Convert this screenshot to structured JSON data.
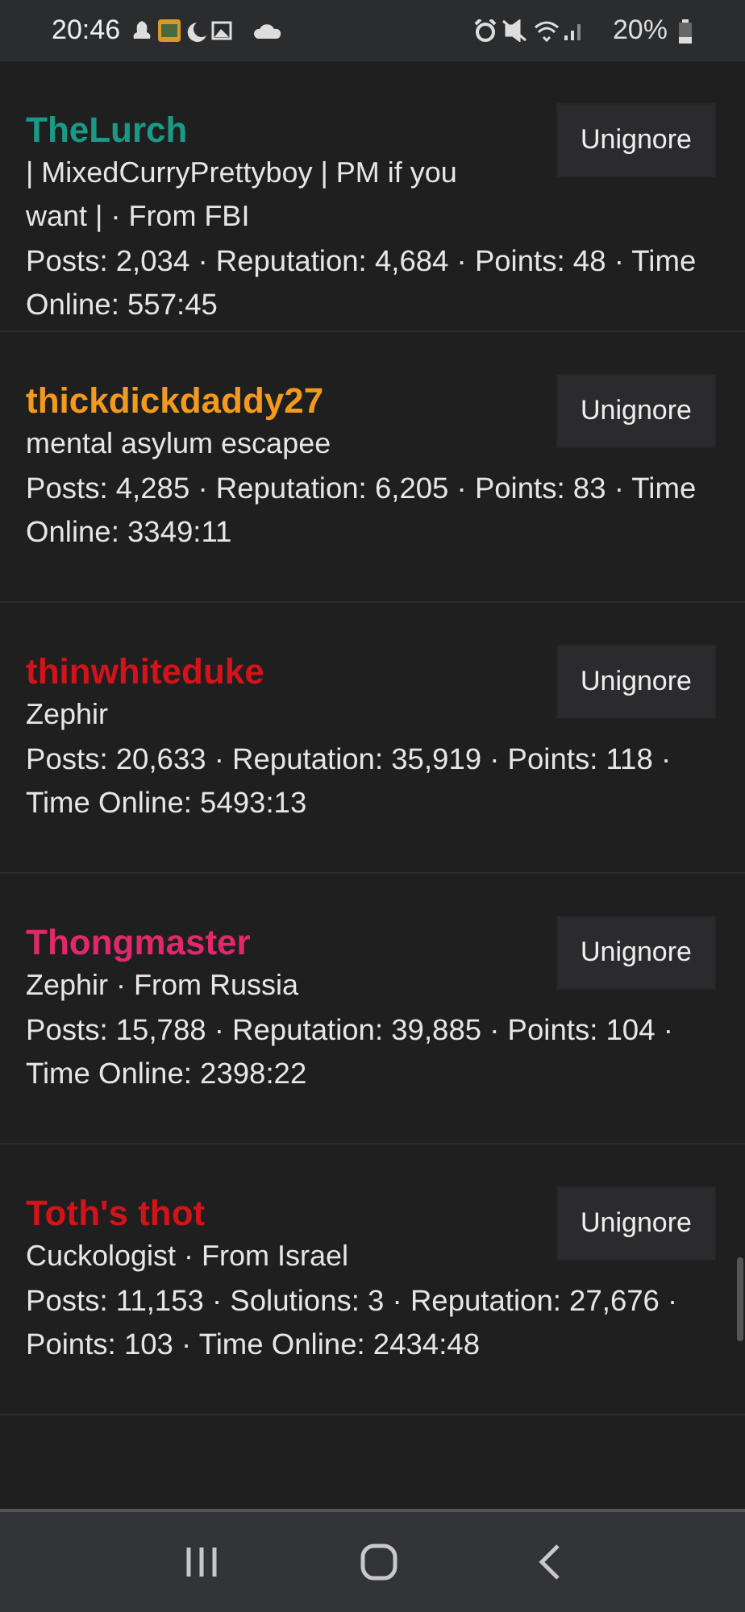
{
  "status_bar": {
    "time": "20:46",
    "battery": "20%"
  },
  "members": [
    {
      "name": "TheLurch",
      "color": "#1a9a86",
      "meta": "| MixedCurryPrettyboy | PM if you want | · From FBI",
      "stats": "Posts: 2,034 · Reputation: 4,684 · Points: 48 · Time Online: 557:45",
      "button": "Unignore"
    },
    {
      "name": "thickdickdaddy27",
      "color": "#f39a1c",
      "meta": "mental asylum escapee",
      "stats": "Posts: 4,285 · Reputation: 6,205 · Points: 83 · Time Online: 3349:11",
      "button": "Unignore"
    },
    {
      "name": "thinwhiteduke",
      "color": "#d3131a",
      "meta": "Zephir",
      "stats": "Posts: 20,633 · Reputation: 35,919 · Points: 118 · Time Online: 5493:13",
      "button": "Unignore"
    },
    {
      "name": "Thongmaster",
      "color": "#e0286a",
      "meta": "Zephir · From Russia",
      "stats": "Posts: 15,788 · Reputation: 39,885 · Points: 104 · Time Online: 2398:22",
      "button": "Unignore"
    },
    {
      "name": "Toth's thot",
      "color": "#d3131a",
      "meta": "Cuckologist · From Israel",
      "stats": "Posts: 11,153 · Solutions: 3 · Reputation: 27,676 · Points: 103 · Time Online: 2434:48",
      "button": "Unignore"
    }
  ]
}
